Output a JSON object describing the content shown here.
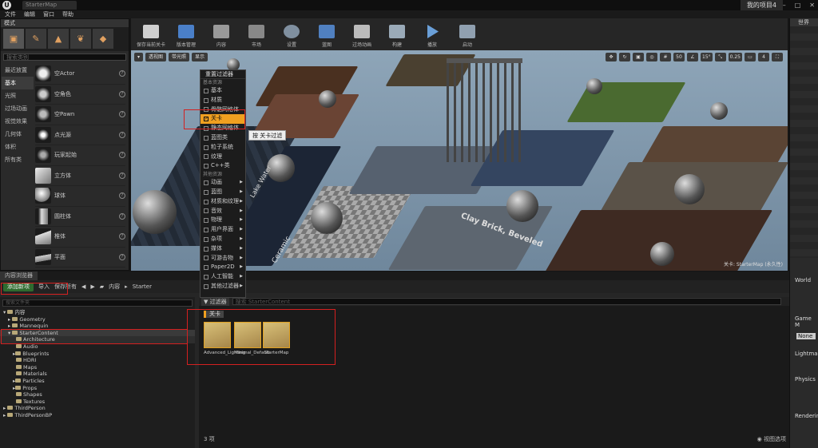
{
  "titlebar": {
    "logo": "U",
    "doc_tab": "StarterMap",
    "project": "我的项目4"
  },
  "menu": [
    "文件",
    "编辑",
    "窗口",
    "帮助"
  ],
  "modes": {
    "title": "模式",
    "search_placeholder": "搜索类别",
    "categories": [
      "最近放置",
      "基本",
      "光照",
      "过场动画",
      "视觉效果",
      "几何体",
      "体积",
      "所有类"
    ],
    "items": [
      "空Actor",
      "空角色",
      "空Pawn",
      "点光源",
      "玩家起始",
      "立方体",
      "球体",
      "圆柱体",
      "椎体",
      "平面"
    ]
  },
  "toolbar": [
    "保存当前关卡",
    "版本管理",
    "内容",
    "市场",
    "设置",
    "蓝图",
    "过场动画",
    "构建",
    "播放",
    "启动"
  ],
  "viewport": {
    "mode_btn": "透视图",
    "lit_btn": "带光照",
    "show_btn": "显示",
    "right_controls": [
      "50",
      "15°",
      "0.25",
      "4"
    ],
    "footer": "关卡: StarterMap (永久性)",
    "texts": [
      "Lake Water",
      "Clay Brick, Beveled",
      "Ceramic"
    ]
  },
  "filter_menu": {
    "header": "重置过滤器",
    "basic_section": "基本资源",
    "basic": [
      "基本",
      "材质",
      "骨骼网格体",
      "关卡",
      "静态网格体",
      "蓝图类",
      "粒子系统",
      "纹理",
      "C++类"
    ],
    "other_section": "其他资源",
    "other": [
      "动画",
      "蓝图",
      "材质和纹理",
      "音效",
      "物理",
      "用户界面",
      "杂项",
      "媒体",
      "可游击物",
      "Paper2D",
      "人工智能",
      "其他过滤器"
    ],
    "tooltip": "按 关卡过滤"
  },
  "content_browser": {
    "tab": "内容浏览器",
    "add_new": "添加新项",
    "import": "导入",
    "save_all": "保存所有",
    "path": [
      "内容",
      "Starter"
    ],
    "search_placeholder": "搜索文件夹",
    "filters_btn": "过滤器",
    "search_content": "搜索 StarterContent",
    "filter_chip": "关卡",
    "item_count": "3 项",
    "view_options": "视图选项",
    "tree": [
      {
        "label": "内容",
        "depth": 0
      },
      {
        "label": "Geometry",
        "depth": 1
      },
      {
        "label": "Mannequin",
        "depth": 1
      },
      {
        "label": "StarterContent",
        "depth": 1
      },
      {
        "label": "Architecture",
        "depth": 2
      },
      {
        "label": "Audio",
        "depth": 2
      },
      {
        "label": "Blueprints",
        "depth": 2
      },
      {
        "label": "HDRI",
        "depth": 2
      },
      {
        "label": "Maps",
        "depth": 2
      },
      {
        "label": "Materials",
        "depth": 2
      },
      {
        "label": "Particles",
        "depth": 2
      },
      {
        "label": "Props",
        "depth": 2
      },
      {
        "label": "Shapes",
        "depth": 2
      },
      {
        "label": "Textures",
        "depth": 2
      },
      {
        "label": "ThirdPerson",
        "depth": 1
      },
      {
        "label": "ThirdPersonBP",
        "depth": 1
      }
    ],
    "assets": [
      "Advanced_Lighting",
      "Minimal_Default",
      "StarterMap"
    ]
  },
  "right_panel": {
    "outliner": "世界",
    "labels": [
      "World",
      "Game M",
      "None",
      "Lightma",
      "Physics",
      "Renderin"
    ]
  },
  "colors": {
    "accent": "#f0a020",
    "highlight_red": "#d42020",
    "add_green": "#2e6b2e"
  }
}
